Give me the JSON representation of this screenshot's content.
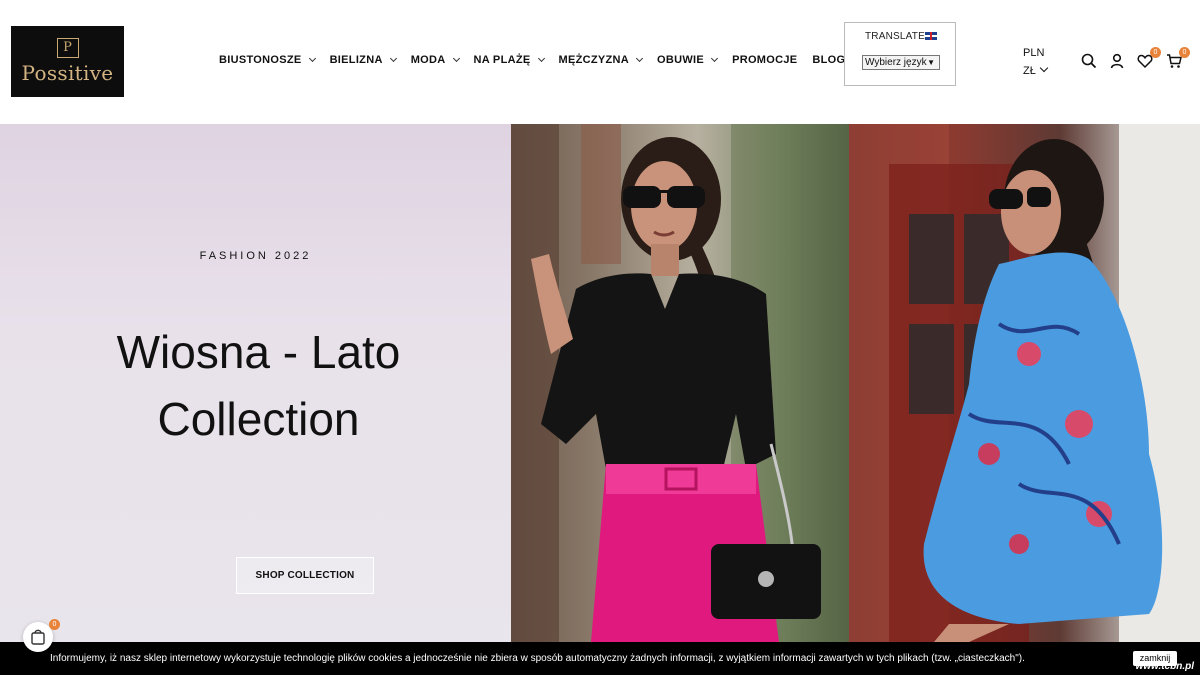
{
  "logo": {
    "mark": "P",
    "text": "Possitive"
  },
  "nav": {
    "items": [
      {
        "label": "BIUSTONOSZE"
      },
      {
        "label": "BIELIZNA"
      },
      {
        "label": "MODA"
      },
      {
        "label": "NA PLAŻĘ"
      },
      {
        "label": "MĘŻCZYZNA"
      },
      {
        "label": "OBUWIE"
      },
      {
        "label": "PROMOCJE"
      },
      {
        "label": "BLOG"
      }
    ]
  },
  "translate": {
    "label": "TRANSLATE",
    "select_value": "Wybierz język"
  },
  "currency": {
    "code": "PLN",
    "symbol": "ZŁ"
  },
  "icons": {
    "search": "search-icon",
    "account": "user-icon",
    "wishlist": "heart-icon",
    "cart": "cart-icon"
  },
  "badges": {
    "wishlist_count": "0",
    "cart_count": "0",
    "floating_cart_count": "0"
  },
  "hero": {
    "kicker": "FASHION 2022",
    "headline_line1": "Wiosna - Lato",
    "headline_line2": "Collection",
    "cta": "SHOP COLLECTION"
  },
  "cookie": {
    "text": "Informujemy, iż nasz sklep internetowy wykorzystuje technologię plików cookies a jednocześnie nie zbiera w sposób automatyczny żadnych informacji, z wyjątkiem informacji zawartych w tych plikach (tzw. „ciasteczkach\").",
    "close_label": "zamknij"
  },
  "watermark": "www.tcbn.pl",
  "colors": {
    "accent": "#e8833a",
    "logo_gold": "#d4b483",
    "hero_bg": "#e8e1ea"
  }
}
